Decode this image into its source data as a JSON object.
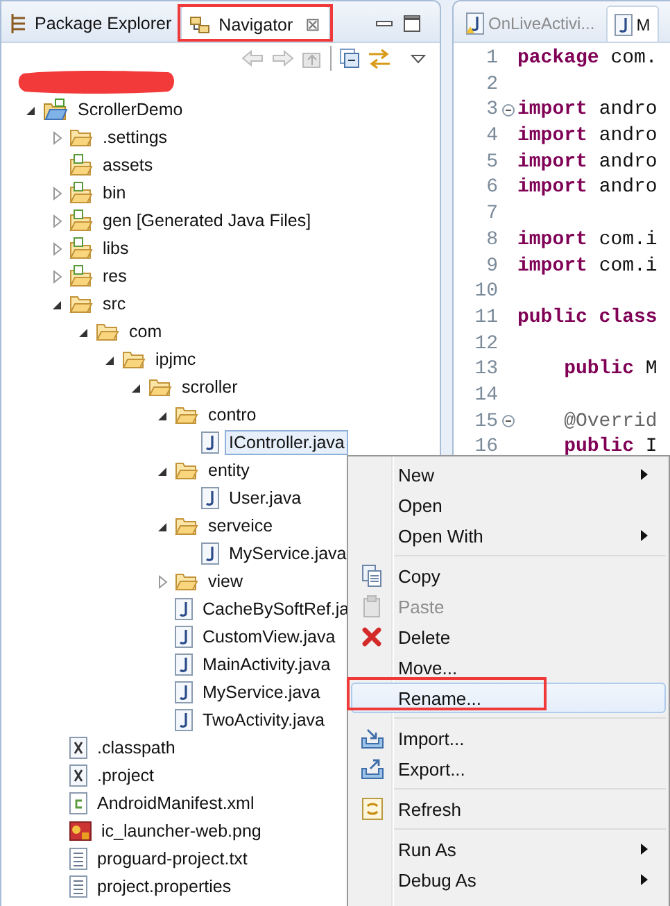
{
  "views": {
    "tabs": [
      {
        "label": "Package Explorer",
        "kind": "hierarchy",
        "selected": false
      },
      {
        "label": "Navigator",
        "kind": "navigator",
        "selected": true,
        "close": "⊠"
      }
    ]
  },
  "tree": [
    {
      "label": "ScrollerDemo",
      "kind": "project",
      "expanded": true,
      "selected": false,
      "children": [
        {
          "label": ".settings",
          "kind": "folder",
          "expanded": false,
          "selected": false
        },
        {
          "label": "assets",
          "kind": "source",
          "selected": false
        },
        {
          "label": "bin",
          "kind": "source",
          "expanded": false,
          "selected": false
        },
        {
          "label": "gen [Generated Java Files]",
          "kind": "source",
          "expanded": false,
          "selected": false
        },
        {
          "label": "libs",
          "kind": "source",
          "expanded": false,
          "selected": false
        },
        {
          "label": "res",
          "kind": "source",
          "expanded": false,
          "selected": false
        },
        {
          "label": "src",
          "kind": "folder",
          "expanded": true,
          "selected": false,
          "children": [
            {
              "label": "com",
              "kind": "folder",
              "expanded": true,
              "selected": false,
              "children": [
                {
                  "label": "ipjmc",
                  "kind": "folder",
                  "expanded": true,
                  "selected": false,
                  "children": [
                    {
                      "label": "scroller",
                      "kind": "folder",
                      "expanded": true,
                      "selected": false,
                      "children": [
                        {
                          "label": "contro",
                          "kind": "folder",
                          "expanded": true,
                          "selected": false,
                          "children": [
                            {
                              "label": "IController.java",
                              "kind": "java",
                              "selected": true
                            }
                          ]
                        },
                        {
                          "label": "entity",
                          "kind": "folder",
                          "expanded": true,
                          "selected": false,
                          "children": [
                            {
                              "label": "User.java",
                              "kind": "java",
                              "selected": false
                            }
                          ]
                        },
                        {
                          "label": "serveice",
                          "kind": "folder",
                          "expanded": true,
                          "selected": false,
                          "children": [
                            {
                              "label": "MyService.java",
                              "kind": "java",
                              "selected": false
                            }
                          ]
                        },
                        {
                          "label": "view",
                          "kind": "folder",
                          "expanded": false,
                          "selected": false
                        },
                        {
                          "label": "CacheBySoftRef.ja",
                          "kind": "java",
                          "selected": false
                        },
                        {
                          "label": "CustomView.java",
                          "kind": "java",
                          "selected": false
                        },
                        {
                          "label": "MainActivity.java",
                          "kind": "java",
                          "selected": false
                        },
                        {
                          "label": "MyService.java",
                          "kind": "java",
                          "selected": false
                        },
                        {
                          "label": "TwoActivity.java",
                          "kind": "java",
                          "selected": false
                        }
                      ]
                    }
                  ]
                }
              ]
            }
          ]
        },
        {
          "label": ".classpath",
          "kind": "xml",
          "selected": false
        },
        {
          "label": ".project",
          "kind": "xml",
          "selected": false
        },
        {
          "label": "AndroidManifest.xml",
          "kind": "manifest",
          "selected": false
        },
        {
          "label": "ic_launcher-web.png",
          "kind": "image",
          "selected": false
        },
        {
          "label": "proguard-project.txt",
          "kind": "text",
          "selected": false
        },
        {
          "label": "project.properties",
          "kind": "text",
          "selected": false
        }
      ]
    }
  ],
  "editor": {
    "tabs": [
      {
        "label": "OnLiveActivi...",
        "kind": "warning",
        "selected": false
      },
      {
        "label": "M",
        "kind": "java",
        "selected": true
      }
    ],
    "lines": [
      {
        "number": "1",
        "fold": false,
        "parts": [
          {
            "kind": "keyword",
            "text": "package"
          },
          {
            "kind": "plain",
            "text": " com."
          }
        ]
      },
      {
        "number": "2",
        "fold": false
      },
      {
        "number": "3",
        "fold": true,
        "parts": [
          {
            "kind": "keyword",
            "text": "import"
          },
          {
            "kind": "plain",
            "text": " andro"
          }
        ]
      },
      {
        "number": "4",
        "fold": false,
        "parts": [
          {
            "kind": "keyword",
            "text": "import"
          },
          {
            "kind": "plain",
            "text": " andro"
          }
        ]
      },
      {
        "number": "5",
        "fold": false,
        "parts": [
          {
            "kind": "keyword",
            "text": "import"
          },
          {
            "kind": "plain",
            "text": " andro"
          }
        ]
      },
      {
        "number": "6",
        "fold": false,
        "parts": [
          {
            "kind": "keyword",
            "text": "import"
          },
          {
            "kind": "plain",
            "text": " andro"
          }
        ]
      },
      {
        "number": "7",
        "fold": false
      },
      {
        "number": "8",
        "fold": false,
        "parts": [
          {
            "kind": "keyword",
            "text": "import"
          },
          {
            "kind": "plain",
            "text": " com.i"
          }
        ]
      },
      {
        "number": "9",
        "fold": false,
        "parts": [
          {
            "kind": "keyword",
            "text": "import"
          },
          {
            "kind": "plain",
            "text": " com.i"
          }
        ]
      },
      {
        "number": "10",
        "fold": false
      },
      {
        "number": "11",
        "fold": false,
        "parts": [
          {
            "kind": "keyword",
            "text": "public class"
          }
        ]
      },
      {
        "number": "12",
        "fold": false
      },
      {
        "number": "13",
        "fold": false,
        "indent": true,
        "parts": [
          {
            "kind": "keyword",
            "text": "public"
          },
          {
            "kind": "plain",
            "text": " M"
          }
        ]
      },
      {
        "number": "14",
        "fold": false
      },
      {
        "number": "15",
        "fold": true,
        "indent": true,
        "parts": [
          {
            "kind": "annotation",
            "text": "@Overrid"
          }
        ]
      },
      {
        "number": "16",
        "fold": false,
        "indent": true,
        "parts": [
          {
            "kind": "keyword",
            "text": "public"
          },
          {
            "kind": "plain",
            "text": " I"
          }
        ]
      }
    ]
  },
  "context_menu": [
    {
      "kind": "item",
      "label": "New",
      "submenu": true,
      "disabled": false,
      "selected": false
    },
    {
      "kind": "item",
      "label": "Open",
      "submenu": false,
      "disabled": false,
      "selected": false
    },
    {
      "kind": "item",
      "label": "Open With",
      "submenu": true,
      "disabled": false,
      "selected": false
    },
    {
      "kind": "separator"
    },
    {
      "kind": "copy",
      "label": "Copy",
      "submenu": false,
      "disabled": false,
      "selected": false
    },
    {
      "kind": "paste",
      "label": "Paste",
      "submenu": false,
      "disabled": true,
      "selected": false
    },
    {
      "kind": "delete",
      "label": "Delete",
      "submenu": false,
      "disabled": false,
      "selected": false
    },
    {
      "kind": "item",
      "label": "Move...",
      "submenu": false,
      "disabled": false,
      "selected": false
    },
    {
      "kind": "item",
      "label": "Rename...",
      "submenu": false,
      "disabled": false,
      "selected": true
    },
    {
      "kind": "separator"
    },
    {
      "kind": "import",
      "label": "Import...",
      "submenu": false,
      "disabled": false,
      "selected": false
    },
    {
      "kind": "export",
      "label": "Export...",
      "submenu": false,
      "disabled": false,
      "selected": false
    },
    {
      "kind": "separator"
    },
    {
      "kind": "refresh",
      "label": "Refresh",
      "submenu": false,
      "disabled": false,
      "selected": false
    },
    {
      "kind": "separator"
    },
    {
      "kind": "item",
      "label": "Run As",
      "submenu": true,
      "disabled": false,
      "selected": false
    },
    {
      "kind": "item",
      "label": "Debug As",
      "submenu": true,
      "disabled": false,
      "selected": false
    }
  ]
}
